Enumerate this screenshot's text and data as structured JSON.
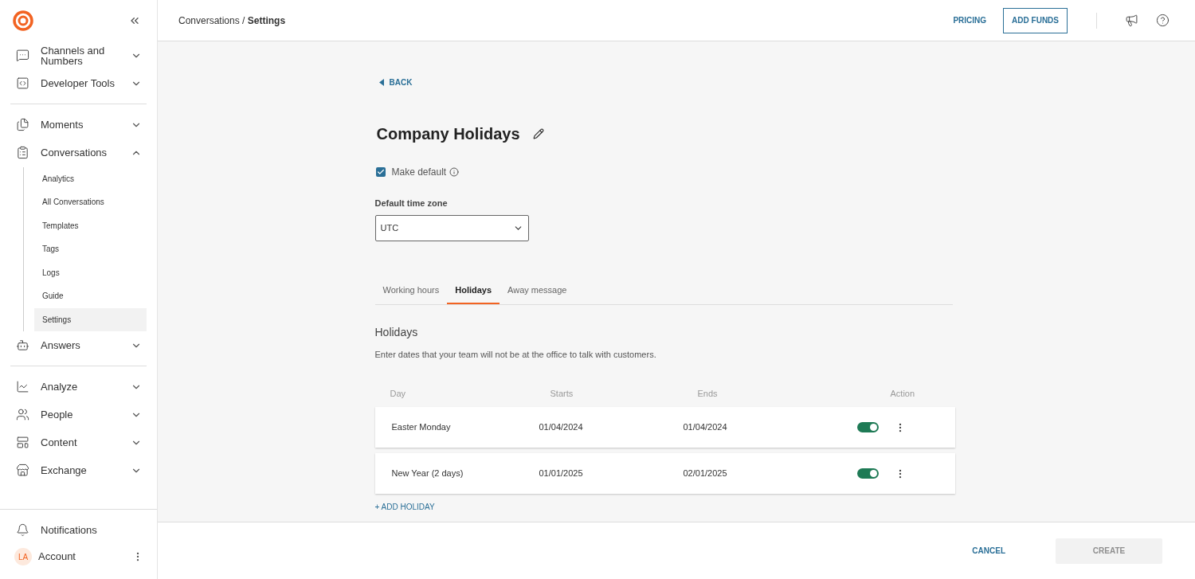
{
  "sidebar": {
    "groups": [
      [
        {
          "label": "Channels and Numbers",
          "expanded": false
        },
        {
          "label": "Developer Tools",
          "expanded": false
        }
      ],
      [
        {
          "label": "Moments",
          "expanded": false
        },
        {
          "label": "Conversations",
          "expanded": true,
          "children": [
            {
              "label": "Analytics",
              "selected": false
            },
            {
              "label": "All Conversations",
              "selected": false
            },
            {
              "label": "Templates",
              "selected": false
            },
            {
              "label": "Tags",
              "selected": false
            },
            {
              "label": "Logs",
              "selected": false
            },
            {
              "label": "Guide",
              "selected": false
            },
            {
              "label": "Settings",
              "selected": true
            }
          ]
        },
        {
          "label": "Answers",
          "expanded": false
        }
      ],
      [
        {
          "label": "Analyze",
          "expanded": false
        },
        {
          "label": "People",
          "expanded": false
        },
        {
          "label": "Content",
          "expanded": false
        },
        {
          "label": "Exchange",
          "expanded": false
        }
      ]
    ],
    "notifications": "Notifications",
    "account": {
      "initials": "LA",
      "label": "Account"
    }
  },
  "header": {
    "breadcrumb": "Conversations / **Settings**",
    "pricing": "PRICING",
    "add_funds": "ADD FUNDS"
  },
  "back": "BACK",
  "title": "Company Holidays",
  "make_default": {
    "label": "Make default",
    "checked": true
  },
  "timezone": {
    "label": "Default time zone",
    "value": "UTC"
  },
  "tabs": [
    {
      "label": "Working hours",
      "selected": false
    },
    {
      "label": "Holidays",
      "selected": true
    },
    {
      "label": "Away message",
      "selected": false
    }
  ],
  "section": {
    "title": "Holidays",
    "description": "Enter dates that your team will not be at the office to talk with customers."
  },
  "table": {
    "columns": [
      "Day",
      "Starts",
      "Ends",
      "Action"
    ],
    "rows": [
      {
        "day": "Easter Monday",
        "starts": "01/04/2024",
        "ends": "01/04/2024",
        "enabled": true
      },
      {
        "day": "New Year (2 days)",
        "starts": "01/01/2025",
        "ends": "02/01/2025",
        "enabled": true
      }
    ]
  },
  "add_holiday": "+ ADD HOLIDAY",
  "footer": {
    "cancel": "CANCEL",
    "create": {
      "label": "CREATE",
      "disabled": true
    }
  }
}
